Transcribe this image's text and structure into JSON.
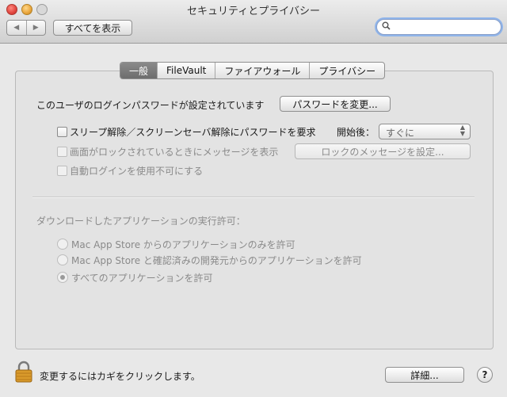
{
  "window": {
    "title": "セキュリティとプライバシー"
  },
  "toolbar": {
    "back": "◀",
    "forward": "▶",
    "show_all": "すべてを表示",
    "search_placeholder": ""
  },
  "tabs": [
    {
      "label": "一般",
      "active": true
    },
    {
      "label": "FileVault",
      "active": false
    },
    {
      "label": "ファイアウォール",
      "active": false
    },
    {
      "label": "プライバシー",
      "active": false
    }
  ],
  "general": {
    "password_status": "このユーザのログインパスワードが設定されています",
    "change_password_button": "パスワードを変更...",
    "require_password_label": "スリープ解除／スクリーンセーバ解除にパスワードを要求",
    "start_after_label": "開始後：",
    "start_after_value": "すぐに",
    "show_message_label": "画面がロックされているときにメッセージを表示",
    "set_lock_message_button": "ロックのメッセージを設定...",
    "disable_autologin_label": "自動ログインを使用不可にする",
    "download_heading": "ダウンロードしたアプリケーションの実行許可：",
    "radio_options": [
      {
        "label": "Mac App Store からのアプリケーションのみを許可",
        "selected": false
      },
      {
        "label": "Mac App Store と確認済みの開発元からのアプリケーションを許可",
        "selected": false
      },
      {
        "label": "すべてのアプリケーションを許可",
        "selected": true
      }
    ]
  },
  "footer": {
    "lock_text": "変更するにはカギをクリックします。",
    "advanced_button": "詳細...",
    "help": "?"
  }
}
